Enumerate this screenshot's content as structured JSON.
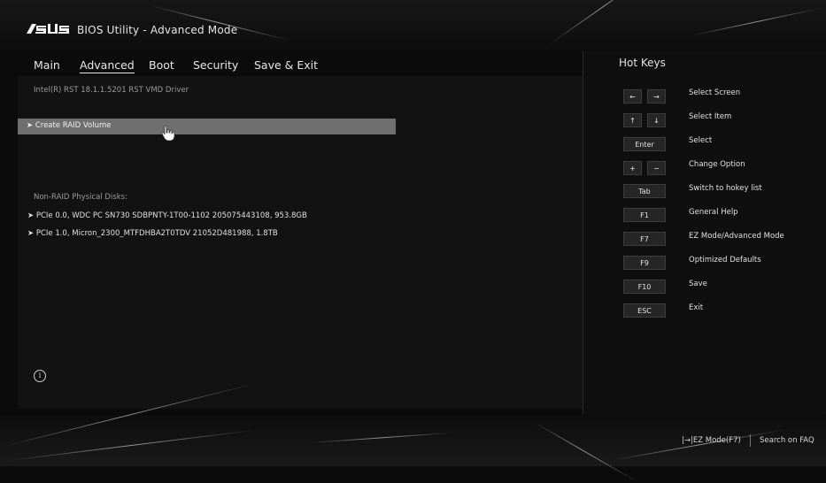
{
  "header": {
    "brand": "ASUS",
    "title": "BIOS Utility - Advanced Mode"
  },
  "tabs": [
    {
      "label": "Main",
      "active": false
    },
    {
      "label": "Advanced",
      "active": true
    },
    {
      "label": "Boot",
      "active": false
    },
    {
      "label": "Security",
      "active": false
    },
    {
      "label": "Save & Exit",
      "active": false
    }
  ],
  "main": {
    "driver": "Intel(R) RST 18.1.1.5201 RST VMD Driver",
    "create_raid": "Create RAID Volume",
    "nonraid_title": "Non-RAID Physical Disks:",
    "disks": [
      "PCIe 0.0, WDC PC SN730 SDBPNTY-1T00-1102 205075443108, 953.8GB",
      "PCIe 1.0, Micron_2300_MTFDHBA2T0TDV 21052D481988, 1.8TB"
    ]
  },
  "hotkeys": {
    "title": "Hot Keys",
    "items": [
      {
        "keys": [
          "←",
          "→"
        ],
        "label": "Select Screen"
      },
      {
        "keys": [
          "↑",
          "↓"
        ],
        "label": "Select Item"
      },
      {
        "keys": [
          "Enter"
        ],
        "label": "Select"
      },
      {
        "keys": [
          "+",
          "−"
        ],
        "label": "Change Option"
      },
      {
        "keys": [
          "Tab"
        ],
        "label": "Switch to hokey list"
      },
      {
        "keys": [
          "F1"
        ],
        "label": "General Help"
      },
      {
        "keys": [
          "F7"
        ],
        "label": "EZ Mode/Advanced Mode"
      },
      {
        "keys": [
          "F9"
        ],
        "label": "Optimized Defaults"
      },
      {
        "keys": [
          "F10"
        ],
        "label": "Save"
      },
      {
        "keys": [
          "ESC"
        ],
        "label": "Exit"
      }
    ]
  },
  "footer": {
    "ez_mode": "|→|EZ Mode(F7)",
    "search": "Search on FAQ"
  }
}
